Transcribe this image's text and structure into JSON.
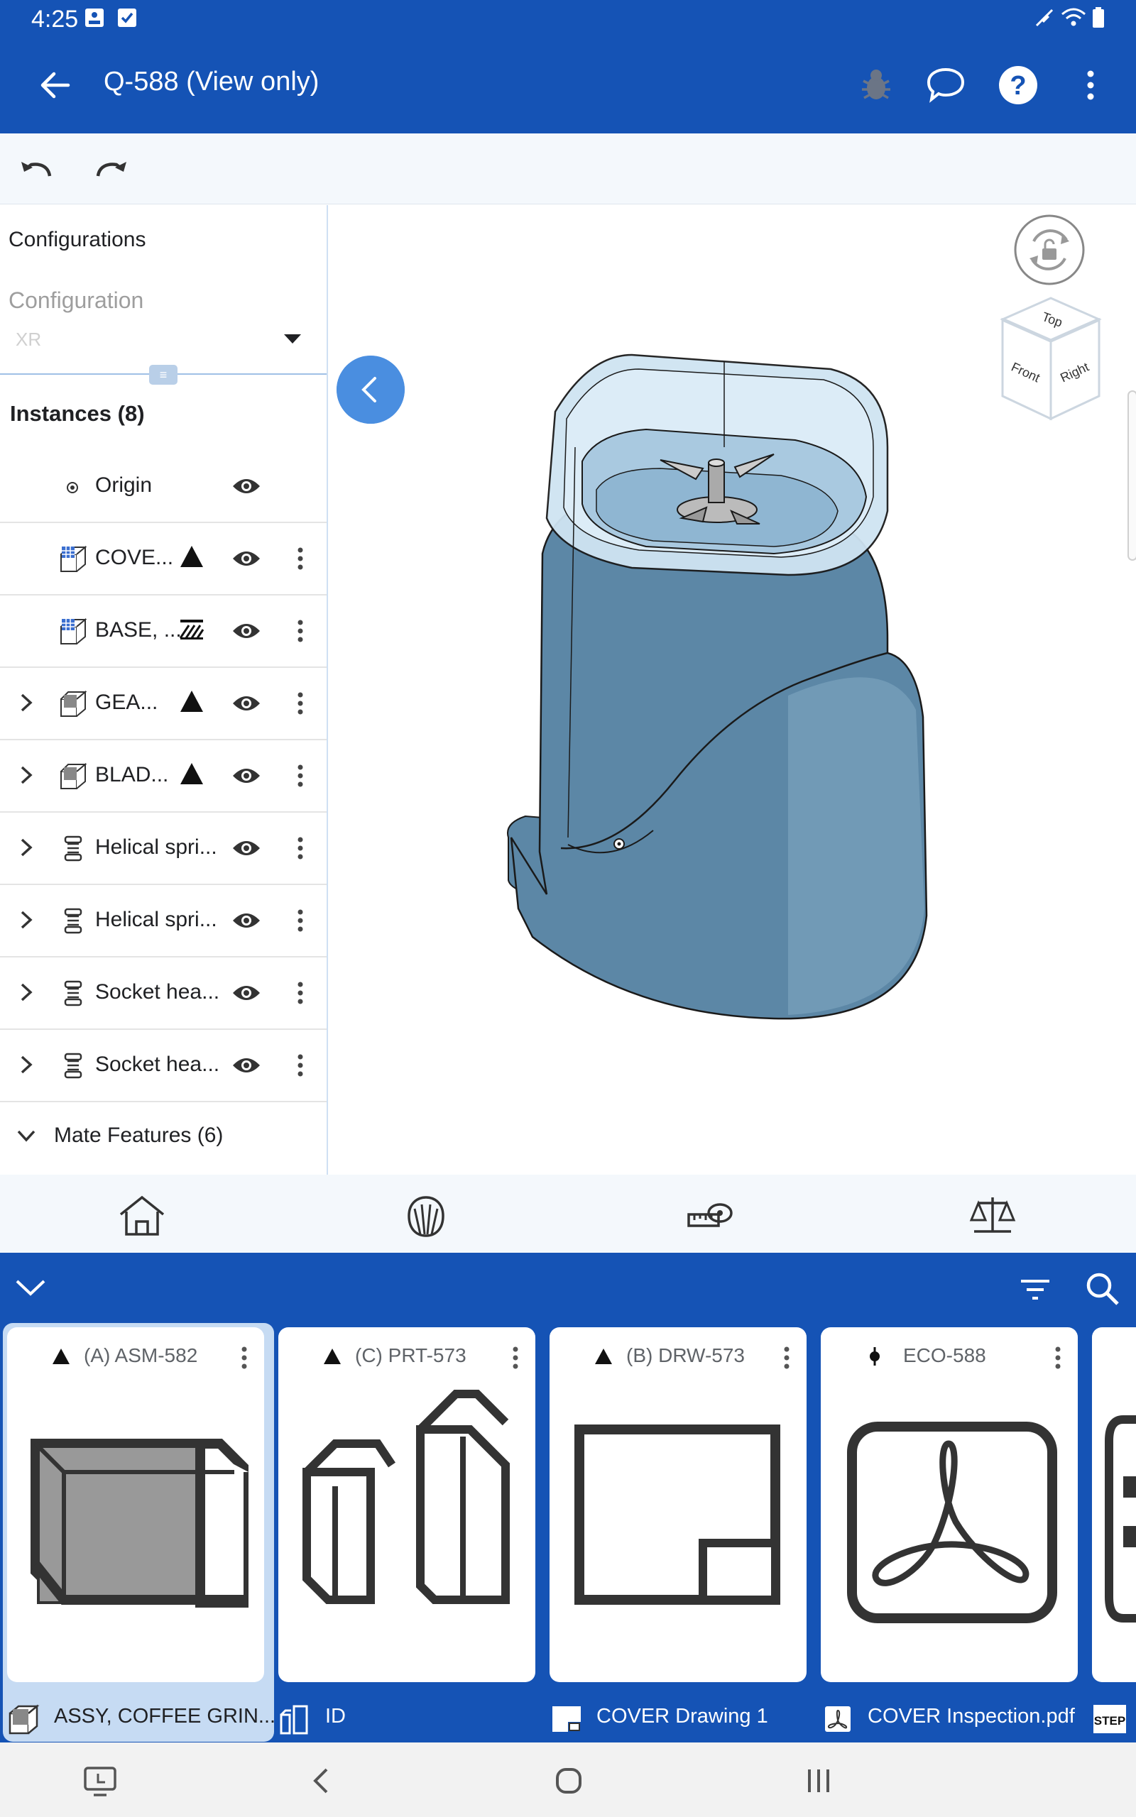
{
  "status_bar": {
    "time": "4:25",
    "icons": [
      "image-notification-icon",
      "check-notification-icon",
      "wifi-icon",
      "battery-icon"
    ]
  },
  "app_bar": {
    "title": "Q-588 (View only)",
    "actions": [
      "bug-icon",
      "comment-icon",
      "help-icon",
      "more-icon"
    ]
  },
  "toolbar": {
    "actions": [
      "undo-icon",
      "redo-icon"
    ]
  },
  "left_panel": {
    "configurations_title": "Configurations",
    "configuration_label": "Configuration",
    "configuration_value": "XR",
    "instances_title": "Instances (8)",
    "instances": [
      {
        "name": "Origin",
        "expandable": false,
        "icon": "origin-icon",
        "state_icon": "",
        "menu": false
      },
      {
        "name": "COVE...",
        "expandable": false,
        "icon": "part-studio-icon",
        "state_icon": "released-triangle-icon",
        "menu": true
      },
      {
        "name": "BASE, ...",
        "expandable": false,
        "icon": "part-studio-icon",
        "state_icon": "hatch-icon",
        "menu": true
      },
      {
        "name": "GEA...",
        "expandable": true,
        "icon": "subassembly-icon",
        "state_icon": "released-triangle-icon",
        "menu": true
      },
      {
        "name": "BLAD...",
        "expandable": true,
        "icon": "subassembly-icon",
        "state_icon": "released-triangle-icon",
        "menu": true
      },
      {
        "name": "Helical spri...",
        "expandable": true,
        "icon": "standard-content-icon",
        "state_icon": "",
        "menu": true
      },
      {
        "name": "Helical spri...",
        "expandable": true,
        "icon": "standard-content-icon",
        "state_icon": "",
        "menu": true
      },
      {
        "name": "Socket hea...",
        "expandable": true,
        "icon": "standard-content-icon",
        "state_icon": "",
        "menu": true
      },
      {
        "name": "Socket hea...",
        "expandable": true,
        "icon": "standard-content-icon",
        "state_icon": "",
        "menu": true
      }
    ],
    "mate_features": "Mate Features (6)"
  },
  "viewport": {
    "view_cube_labels": {
      "top": "Top",
      "front": "Front",
      "right": "Right"
    },
    "colors": {
      "model_body": "#5c87a6",
      "model_glass": "#cfe4f2",
      "accent": "#4a8ee0"
    }
  },
  "tool_nav": [
    "home-icon",
    "appearance-icon",
    "measure-icon",
    "mass-properties-icon"
  ],
  "documents": {
    "cards": [
      {
        "revision": "(A) ASM-582",
        "rev_icon": "released-triangle-icon",
        "name": "ASSY, COFFEE GRIN...",
        "type": "assembly",
        "selected": true
      },
      {
        "revision": "(C) PRT-573",
        "rev_icon": "released-triangle-icon",
        "name": "ID",
        "type": "part-studio",
        "selected": false
      },
      {
        "revision": "(B) DRW-573",
        "rev_icon": "released-triangle-icon",
        "name": "COVER Drawing 1",
        "type": "drawing",
        "selected": false
      },
      {
        "revision": "ECO-588",
        "rev_icon": "eco-icon",
        "name": "COVER Inspection.pdf",
        "type": "pdf",
        "selected": false
      }
    ],
    "partial_card_label": "STEP"
  },
  "system_nav": [
    "recents-screen-icon",
    "back-icon",
    "home-circle-icon",
    "recent-apps-icon"
  ],
  "colors": {
    "primary": "#1553b5",
    "toolbar_bg": "#f4f8fc",
    "selected_card": "#c6dbf3"
  }
}
